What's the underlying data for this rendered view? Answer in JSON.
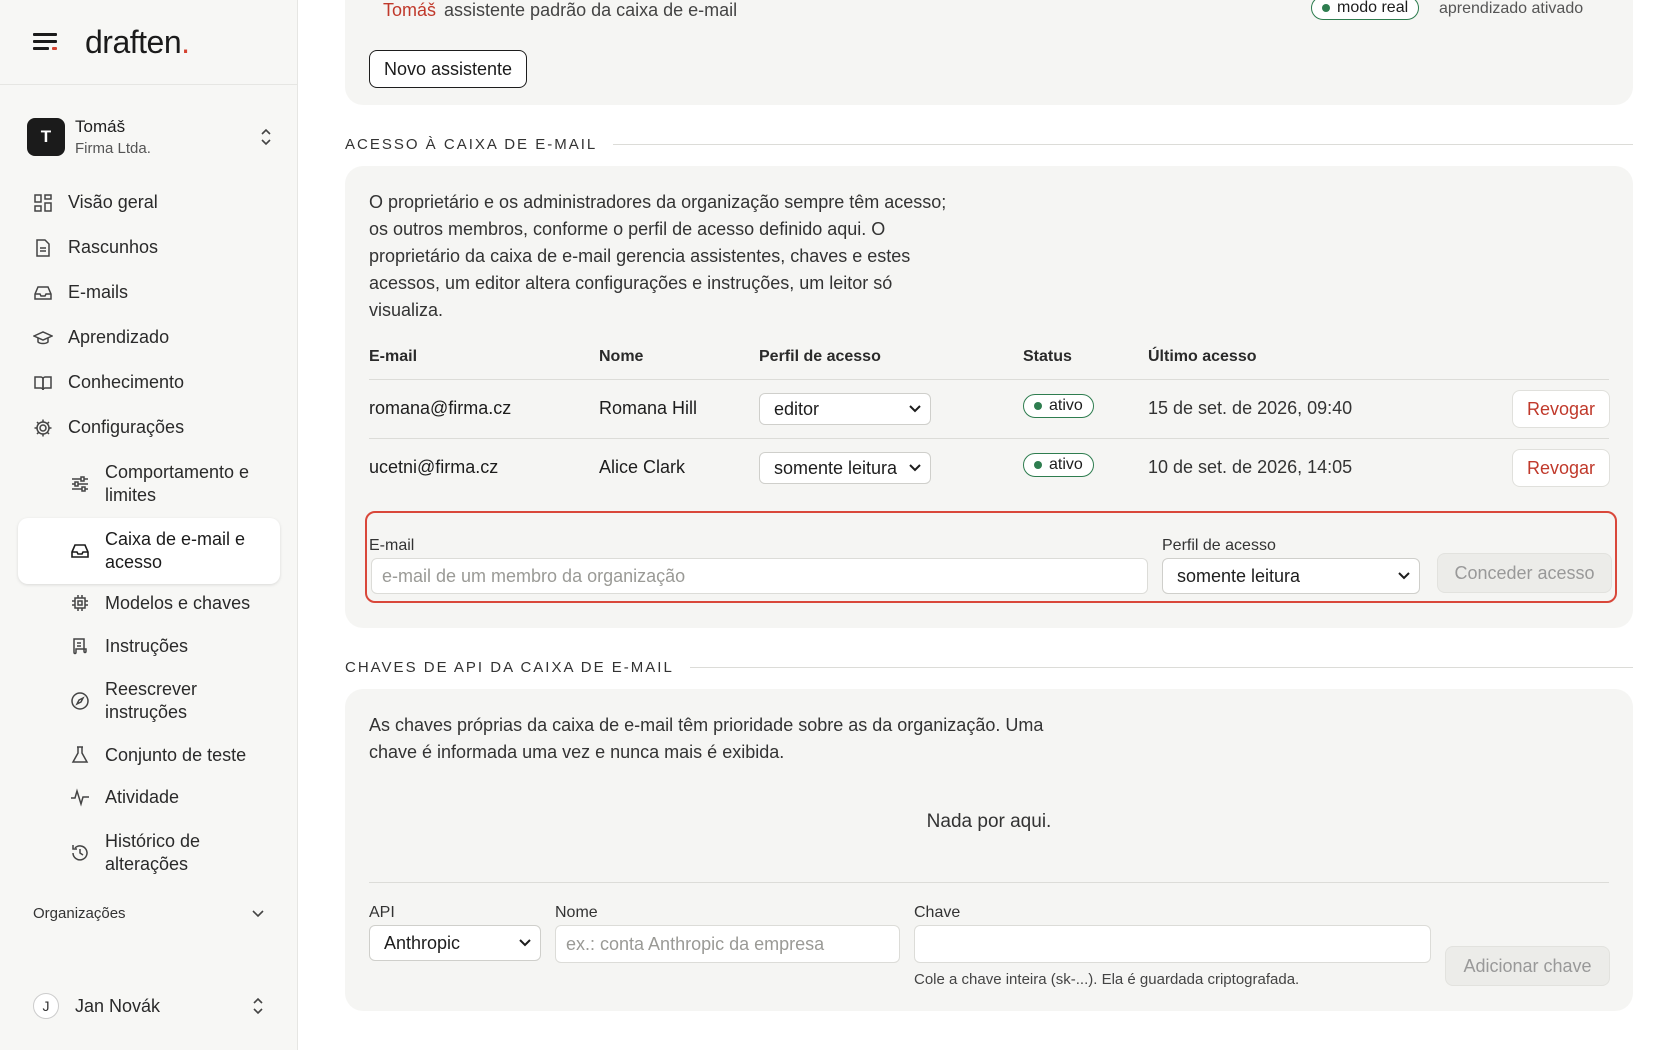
{
  "brand": {
    "name": "draften",
    "dot": "."
  },
  "account": {
    "initial": "T",
    "name": "Tomáš",
    "company": "Firma Ltda."
  },
  "nav": {
    "overview": "Visão geral",
    "drafts": "Rascunhos",
    "emails": "E-mails",
    "learned": "Aprendizado",
    "knowledge": "Conhecimento",
    "settings": "Configurações"
  },
  "subnav": {
    "behavior": "Comportamento e limites",
    "mailbox": "Caixa de e-mail e acesso",
    "models": "Modelos e chaves",
    "instructions": "Instruções",
    "rewrite": "Reescrever instruções",
    "testset": "Conjunto de teste",
    "activity": "Atividade",
    "history": "Histórico de alterações"
  },
  "orgs_label": "Organizações",
  "user": {
    "initial": "J",
    "name": "Jan Novák"
  },
  "assistant": {
    "owner": "Tomáš",
    "text": "assistente padrão da caixa de e-mail",
    "mode": "modo real",
    "learning": "aprendizado ativado",
    "new_button": "Novo assistente"
  },
  "access": {
    "title": "ACESSO À CAIXA DE E-MAIL",
    "description": "O proprietário e os administradores da organização sempre têm acesso; os outros membros, conforme o perfil de acesso definido aqui. O proprietário da caixa de e-mail gerencia assistentes, chaves e estes acessos, um editor altera configurações e instruções, um leitor só visualiza.",
    "columns": {
      "email": "E-mail",
      "name": "Nome",
      "role": "Perfil de acesso",
      "status": "Status",
      "last": "Último acesso"
    },
    "rows": [
      {
        "email": "romana@firma.cz",
        "name": "Romana Hill",
        "role": "editor",
        "status": "ativo",
        "last": "15 de set. de 2026, 09:40",
        "action": "Revogar"
      },
      {
        "email": "ucetni@firma.cz",
        "name": "Alice Clark",
        "role": "somente leitura",
        "status": "ativo",
        "last": "10 de set. de 2026, 14:05",
        "action": "Revogar"
      }
    ],
    "form": {
      "email_label": "E-mail",
      "email_placeholder": "e-mail de um membro da organização",
      "role_label": "Perfil de acesso",
      "role_value": "somente leitura",
      "grant_button": "Conceder acesso"
    }
  },
  "keys": {
    "title": "CHAVES DE API DA CAIXA DE E-MAIL",
    "description": "As chaves próprias da caixa de e-mail têm prioridade sobre as da organização. Uma chave é informada uma vez e nunca mais é exibida.",
    "empty": "Nada por aqui.",
    "form": {
      "api_label": "API",
      "api_value": "Anthropic",
      "name_label": "Nome",
      "name_placeholder": "ex.: conta Anthropic da empresa",
      "key_label": "Chave",
      "key_help": "Cole a chave inteira (sk-...). Ela é guardada criptografada.",
      "add_button": "Adicionar chave"
    }
  },
  "colors": {
    "accent": "#d4422f",
    "danger": "#c0392b",
    "success": "#2e7d4f",
    "highlight": "#d9473a"
  }
}
